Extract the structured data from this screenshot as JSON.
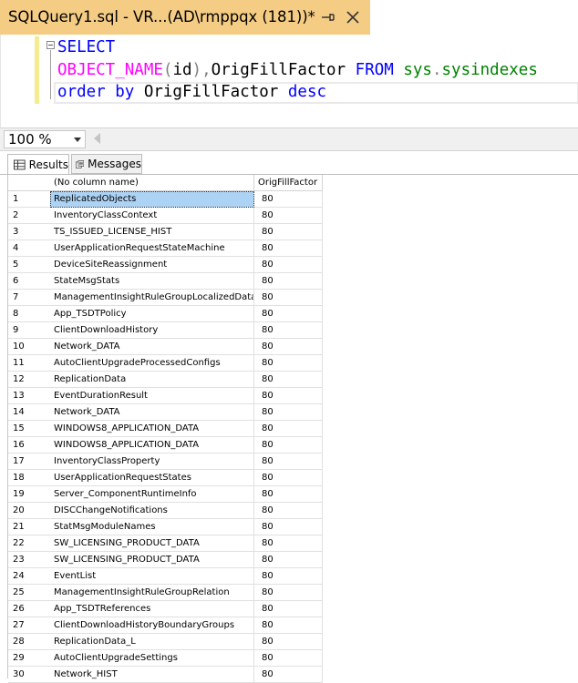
{
  "tab": {
    "title": "SQLQuery1.sql - VR...(AD\\rmppqx (181))*"
  },
  "editor": {
    "lines": [
      [
        {
          "t": "SELECT",
          "c": "kw"
        }
      ],
      [
        {
          "t": "OBJECT_NAME",
          "c": "fn"
        },
        {
          "t": "(",
          "c": "gray"
        },
        {
          "t": "id",
          "c": "plain"
        },
        {
          "t": "),",
          "c": "gray"
        },
        {
          "t": "OrigFillFactor ",
          "c": "plain"
        },
        {
          "t": "FROM ",
          "c": "kw"
        },
        {
          "t": "sys",
          "c": "sys"
        },
        {
          "t": ".",
          "c": "gray"
        },
        {
          "t": "sysindexes",
          "c": "sys"
        }
      ],
      [
        {
          "t": "order by ",
          "c": "kw"
        },
        {
          "t": "OrigFillFactor ",
          "c": "plain"
        },
        {
          "t": "desc",
          "c": "kw"
        }
      ]
    ]
  },
  "zoom": {
    "value": "100 %"
  },
  "results_tabs": {
    "results": "Results",
    "messages": "Messages"
  },
  "grid": {
    "columns": [
      "(No column name)",
      "OrigFillFactor"
    ],
    "rows": [
      [
        "1",
        "ReplicatedObjects",
        "80"
      ],
      [
        "2",
        "InventoryClassContext",
        "80"
      ],
      [
        "3",
        "TS_ISSUED_LICENSE_HIST",
        "80"
      ],
      [
        "4",
        "UserApplicationRequestStateMachine",
        "80"
      ],
      [
        "5",
        "DeviceSiteReassignment",
        "80"
      ],
      [
        "6",
        "StateMsgStats",
        "80"
      ],
      [
        "7",
        "ManagementInsightRuleGroupLocalizedData",
        "80"
      ],
      [
        "8",
        "App_TSDTPolicy",
        "80"
      ],
      [
        "9",
        "ClientDownloadHistory",
        "80"
      ],
      [
        "10",
        "Network_DATA",
        "80"
      ],
      [
        "11",
        "AutoClientUpgradeProcessedConfigs",
        "80"
      ],
      [
        "12",
        "ReplicationData",
        "80"
      ],
      [
        "13",
        "EventDurationResult",
        "80"
      ],
      [
        "14",
        "Network_DATA",
        "80"
      ],
      [
        "15",
        "WINDOWS8_APPLICATION_DATA",
        "80"
      ],
      [
        "16",
        "WINDOWS8_APPLICATION_DATA",
        "80"
      ],
      [
        "17",
        "InventoryClassProperty",
        "80"
      ],
      [
        "18",
        "UserApplicationRequestStates",
        "80"
      ],
      [
        "19",
        "Server_ComponentRuntimeInfo",
        "80"
      ],
      [
        "20",
        "DISCChangeNotifications",
        "80"
      ],
      [
        "21",
        "StatMsgModuleNames",
        "80"
      ],
      [
        "22",
        "SW_LICENSING_PRODUCT_DATA",
        "80"
      ],
      [
        "23",
        "SW_LICENSING_PRODUCT_DATA",
        "80"
      ],
      [
        "24",
        "EventList",
        "80"
      ],
      [
        "25",
        "ManagementInsightRuleGroupRelation",
        "80"
      ],
      [
        "26",
        "App_TSDTReferences",
        "80"
      ],
      [
        "27",
        "ClientDownloadHistoryBoundaryGroups",
        "80"
      ],
      [
        "28",
        "ReplicationData_L",
        "80"
      ],
      [
        "29",
        "AutoClientUpgradeSettings",
        "80"
      ],
      [
        "30",
        "Network_HIST",
        "80"
      ]
    ],
    "selected_row": 1
  },
  "colors": {
    "tab_active": "#f5cc84",
    "keyword": "#0000ff",
    "function": "#ff00ff",
    "system_object": "#008000",
    "selection": "#add3f4"
  }
}
